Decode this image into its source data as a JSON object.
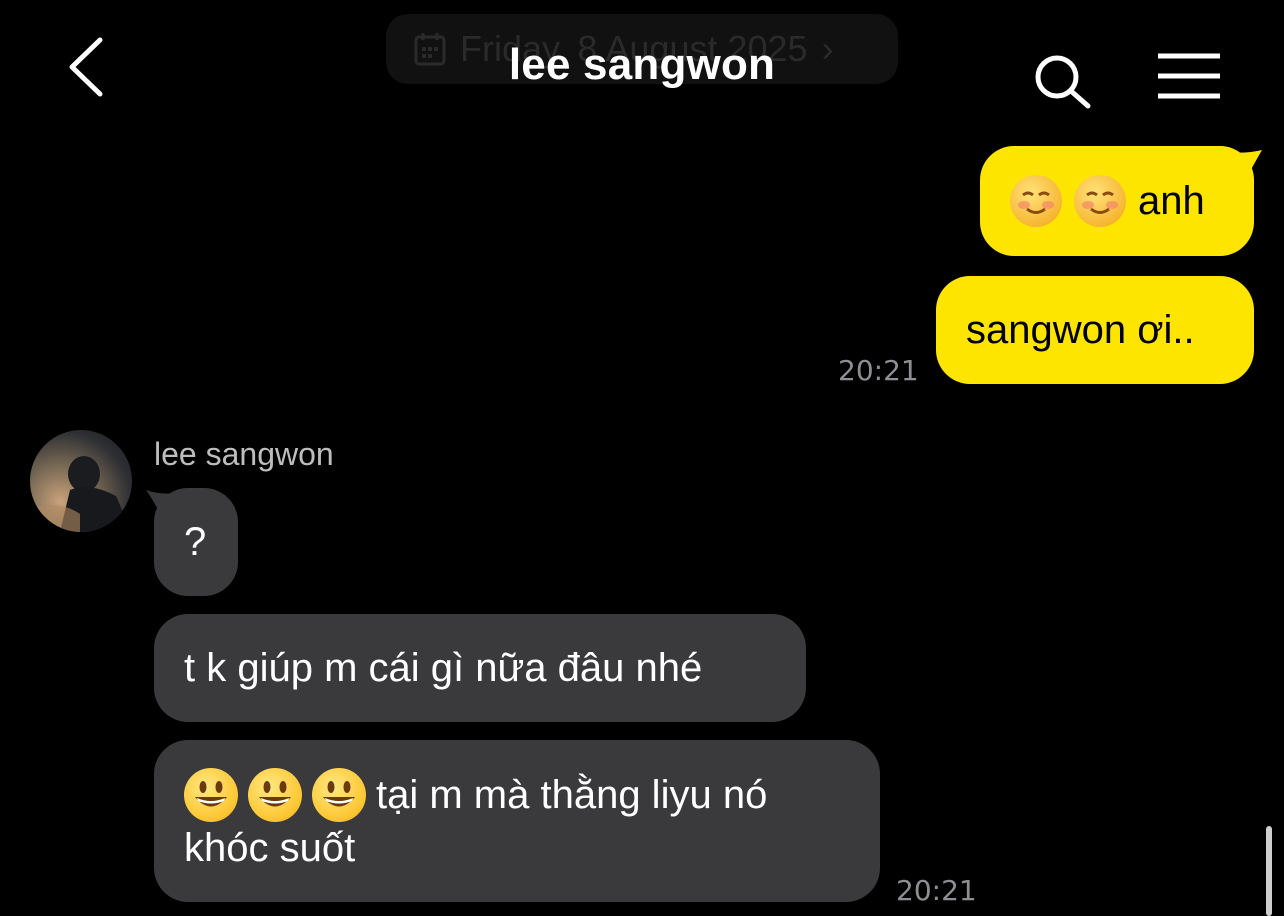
{
  "header": {
    "date_label": "Friday, 8 August 2025",
    "date_chevron": "›",
    "title": "lee sangwon",
    "back_icon": "chevron-left-icon",
    "search_icon": "search-icon",
    "menu_icon": "hamburger-menu-icon"
  },
  "colors": {
    "outgoing_bubble": "#fee500",
    "incoming_bubble": "#3a3a3c",
    "background": "#000000",
    "timestamp": "#8e8e93"
  },
  "messages": {
    "out_1": {
      "text": "anh",
      "emojis": [
        "smiling-face-emoji",
        "smiling-face-emoji"
      ]
    },
    "out_2": {
      "text": "sangwon ơi..",
      "time": "20:21"
    },
    "sender_name": "lee sangwon",
    "in_1": {
      "text": "?"
    },
    "in_2": {
      "text": "t k giúp m cái gì nữa đâu nhé"
    },
    "in_3": {
      "line1": "tại m mà thằng liyu nó",
      "line2": "khóc suốt",
      "emojis": [
        "grinning-face-emoji",
        "grinning-face-emoji",
        "grinning-face-emoji"
      ],
      "time": "20:21"
    }
  }
}
